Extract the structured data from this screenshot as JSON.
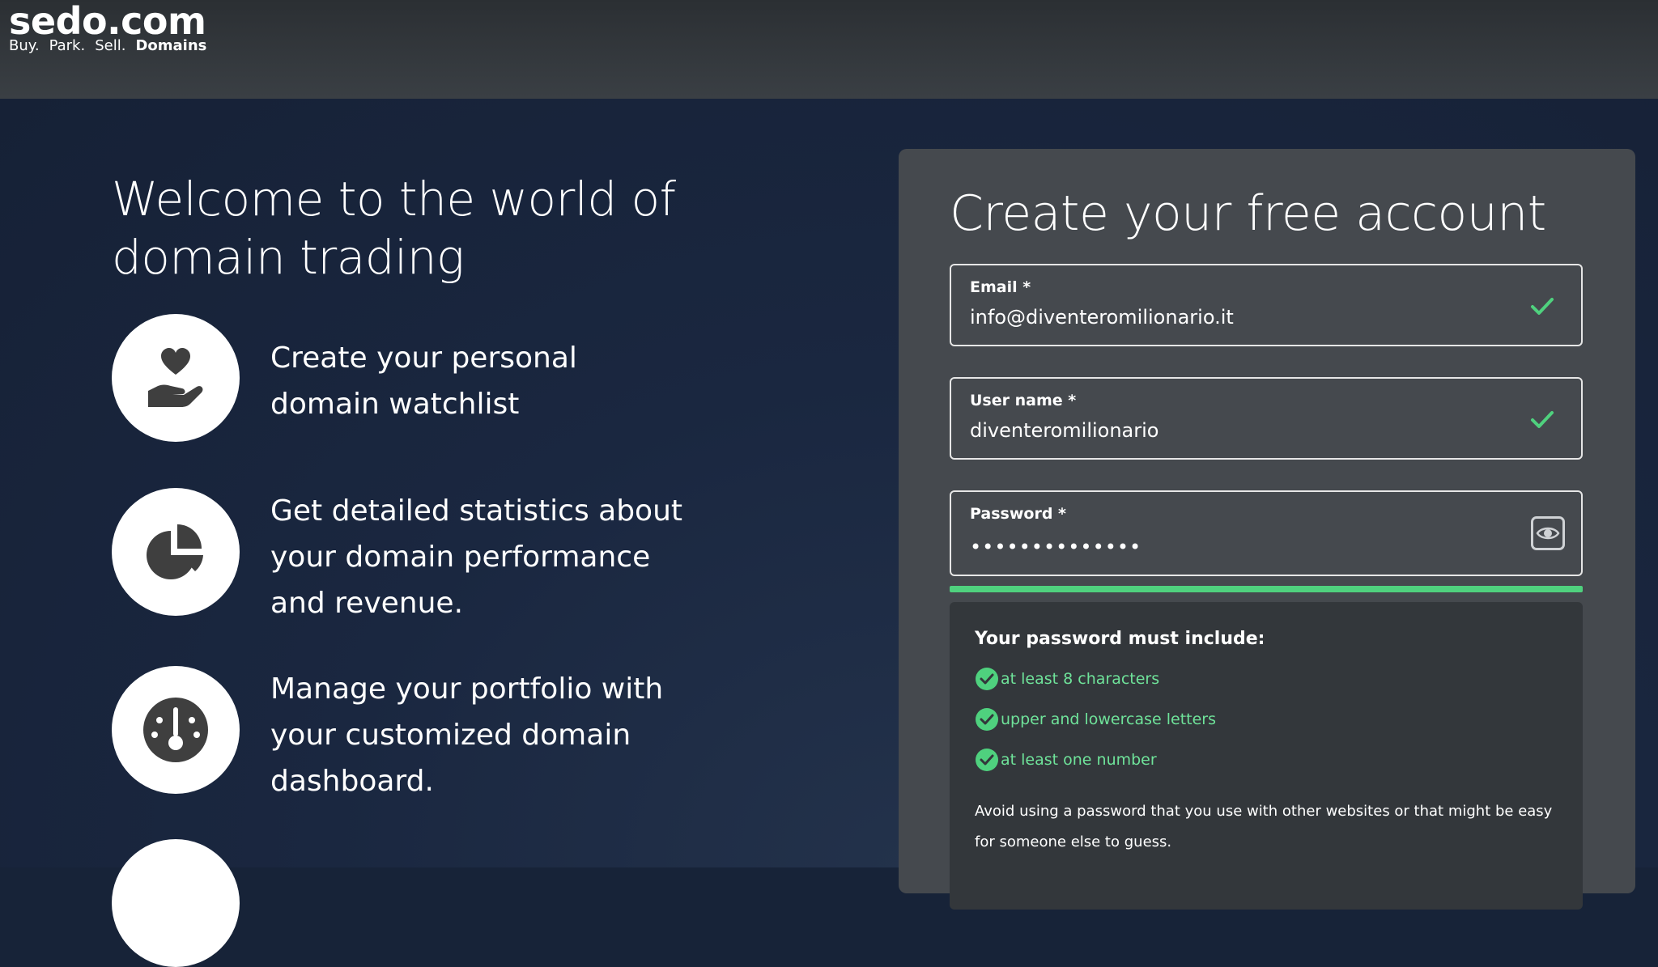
{
  "header": {
    "logo": "sedo.com",
    "tagline": [
      "Buy.",
      "Park.",
      "Sell.",
      "Domains"
    ]
  },
  "hero": {
    "title": "Welcome to the world of domain trading",
    "features": [
      {
        "icon": "heart-hand-icon",
        "text": "Create your personal domain watchlist"
      },
      {
        "icon": "pie-chart-icon",
        "text": "Get detailed statistics about your domain performance and revenue."
      },
      {
        "icon": "dashboard-gauge-icon",
        "text": "Manage your portfolio with your customized domain dashboard."
      }
    ]
  },
  "form": {
    "title": "Create your free account",
    "email": {
      "label": "Email *",
      "value": "info@diventeromilionario.it"
    },
    "username": {
      "label": "User name *",
      "value": "diventeromilionario"
    },
    "password": {
      "label": "Password *",
      "value": "••••••••••••••",
      "strength": 1.0
    },
    "rules": {
      "title": "Your password must include:",
      "items": [
        "at least 8 characters",
        "upper and lowercase letters",
        "at least one number"
      ],
      "note": "Avoid using a password that you use with other websites or that might be easy for someone else to guess."
    }
  },
  "colors": {
    "accent_green": "#4fd17e",
    "rule_text": "#6fe39a",
    "card_bg": "#45494e",
    "page_bg": "#172338"
  }
}
